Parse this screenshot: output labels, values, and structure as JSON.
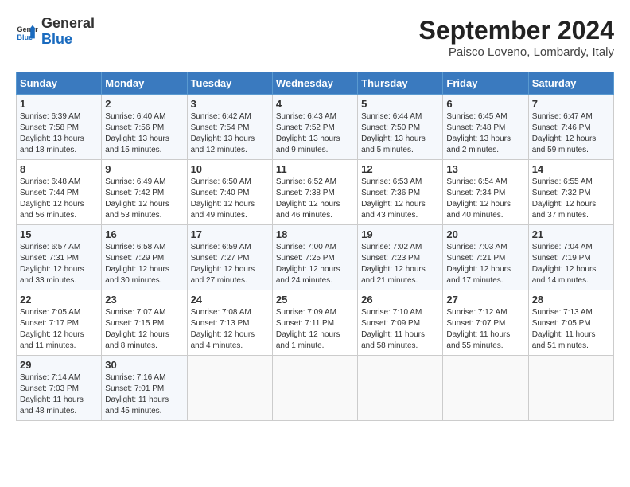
{
  "header": {
    "logo": {
      "general": "General",
      "blue": "Blue"
    },
    "title": "September 2024",
    "location": "Paisco Loveno, Lombardy, Italy"
  },
  "calendar": {
    "headers": [
      "Sunday",
      "Monday",
      "Tuesday",
      "Wednesday",
      "Thursday",
      "Friday",
      "Saturday"
    ],
    "weeks": [
      [
        {
          "day": "",
          "empty": true
        },
        {
          "day": "",
          "empty": true
        },
        {
          "day": "",
          "empty": true
        },
        {
          "day": "",
          "empty": true
        },
        {
          "day": "",
          "empty": true
        },
        {
          "day": "",
          "empty": true
        },
        {
          "day": "",
          "empty": true
        }
      ],
      [
        {
          "day": "1",
          "sunrise": "6:39 AM",
          "sunset": "7:58 PM",
          "daylight": "13 hours and 18 minutes."
        },
        {
          "day": "2",
          "sunrise": "6:40 AM",
          "sunset": "7:56 PM",
          "daylight": "13 hours and 15 minutes."
        },
        {
          "day": "3",
          "sunrise": "6:42 AM",
          "sunset": "7:54 PM",
          "daylight": "13 hours and 12 minutes."
        },
        {
          "day": "4",
          "sunrise": "6:43 AM",
          "sunset": "7:52 PM",
          "daylight": "13 hours and 9 minutes."
        },
        {
          "day": "5",
          "sunrise": "6:44 AM",
          "sunset": "7:50 PM",
          "daylight": "13 hours and 5 minutes."
        },
        {
          "day": "6",
          "sunrise": "6:45 AM",
          "sunset": "7:48 PM",
          "daylight": "13 hours and 2 minutes."
        },
        {
          "day": "7",
          "sunrise": "6:47 AM",
          "sunset": "7:46 PM",
          "daylight": "12 hours and 59 minutes."
        }
      ],
      [
        {
          "day": "8",
          "sunrise": "6:48 AM",
          "sunset": "7:44 PM",
          "daylight": "12 hours and 56 minutes."
        },
        {
          "day": "9",
          "sunrise": "6:49 AM",
          "sunset": "7:42 PM",
          "daylight": "12 hours and 53 minutes."
        },
        {
          "day": "10",
          "sunrise": "6:50 AM",
          "sunset": "7:40 PM",
          "daylight": "12 hours and 49 minutes."
        },
        {
          "day": "11",
          "sunrise": "6:52 AM",
          "sunset": "7:38 PM",
          "daylight": "12 hours and 46 minutes."
        },
        {
          "day": "12",
          "sunrise": "6:53 AM",
          "sunset": "7:36 PM",
          "daylight": "12 hours and 43 minutes."
        },
        {
          "day": "13",
          "sunrise": "6:54 AM",
          "sunset": "7:34 PM",
          "daylight": "12 hours and 40 minutes."
        },
        {
          "day": "14",
          "sunrise": "6:55 AM",
          "sunset": "7:32 PM",
          "daylight": "12 hours and 37 minutes."
        }
      ],
      [
        {
          "day": "15",
          "sunrise": "6:57 AM",
          "sunset": "7:31 PM",
          "daylight": "12 hours and 33 minutes."
        },
        {
          "day": "16",
          "sunrise": "6:58 AM",
          "sunset": "7:29 PM",
          "daylight": "12 hours and 30 minutes."
        },
        {
          "day": "17",
          "sunrise": "6:59 AM",
          "sunset": "7:27 PM",
          "daylight": "12 hours and 27 minutes."
        },
        {
          "day": "18",
          "sunrise": "7:00 AM",
          "sunset": "7:25 PM",
          "daylight": "12 hours and 24 minutes."
        },
        {
          "day": "19",
          "sunrise": "7:02 AM",
          "sunset": "7:23 PM",
          "daylight": "12 hours and 21 minutes."
        },
        {
          "day": "20",
          "sunrise": "7:03 AM",
          "sunset": "7:21 PM",
          "daylight": "12 hours and 17 minutes."
        },
        {
          "day": "21",
          "sunrise": "7:04 AM",
          "sunset": "7:19 PM",
          "daylight": "12 hours and 14 minutes."
        }
      ],
      [
        {
          "day": "22",
          "sunrise": "7:05 AM",
          "sunset": "7:17 PM",
          "daylight": "12 hours and 11 minutes."
        },
        {
          "day": "23",
          "sunrise": "7:07 AM",
          "sunset": "7:15 PM",
          "daylight": "12 hours and 8 minutes."
        },
        {
          "day": "24",
          "sunrise": "7:08 AM",
          "sunset": "7:13 PM",
          "daylight": "12 hours and 4 minutes."
        },
        {
          "day": "25",
          "sunrise": "7:09 AM",
          "sunset": "7:11 PM",
          "daylight": "12 hours and 1 minute."
        },
        {
          "day": "26",
          "sunrise": "7:10 AM",
          "sunset": "7:09 PM",
          "daylight": "11 hours and 58 minutes."
        },
        {
          "day": "27",
          "sunrise": "7:12 AM",
          "sunset": "7:07 PM",
          "daylight": "11 hours and 55 minutes."
        },
        {
          "day": "28",
          "sunrise": "7:13 AM",
          "sunset": "7:05 PM",
          "daylight": "11 hours and 51 minutes."
        }
      ],
      [
        {
          "day": "29",
          "sunrise": "7:14 AM",
          "sunset": "7:03 PM",
          "daylight": "11 hours and 48 minutes."
        },
        {
          "day": "30",
          "sunrise": "7:16 AM",
          "sunset": "7:01 PM",
          "daylight": "11 hours and 45 minutes."
        },
        {
          "day": "",
          "empty": true
        },
        {
          "day": "",
          "empty": true
        },
        {
          "day": "",
          "empty": true
        },
        {
          "day": "",
          "empty": true
        },
        {
          "day": "",
          "empty": true
        }
      ]
    ]
  },
  "labels": {
    "sunrise": "Sunrise:",
    "sunset": "Sunset:",
    "daylight": "Daylight:"
  }
}
